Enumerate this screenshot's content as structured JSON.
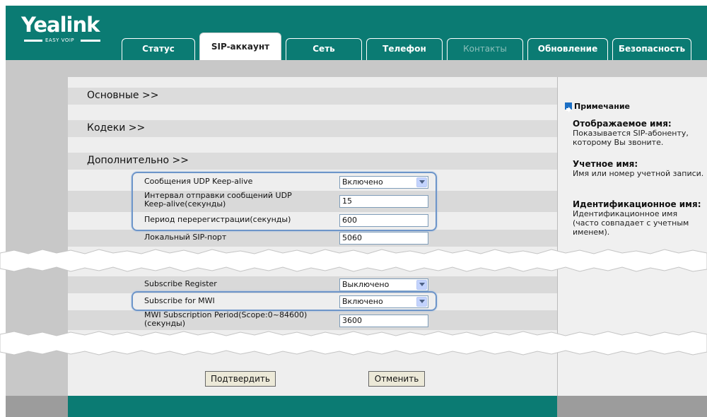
{
  "brand": {
    "name": "Yealink",
    "tagline": "EASY VOIP"
  },
  "tabs": [
    {
      "label": "Статус"
    },
    {
      "label": "SIP-аккаунт"
    },
    {
      "label": "Сеть"
    },
    {
      "label": "Телефон"
    },
    {
      "label": "Контакты"
    },
    {
      "label": "Обновление"
    },
    {
      "label": "Безопасность"
    }
  ],
  "active_tab": "SIP-аккаунт",
  "sections": {
    "basic": "Основные >>",
    "codecs": "Кодеки >>",
    "advanced": "Дополнительно >>"
  },
  "settings": {
    "udp_keepalive_label": "Сообщения UDP Keep-alive",
    "udp_keepalive_value": "Включено",
    "keepalive_interval_label": "Интервал отправки сообщений UDP Keep-alive(секунды)",
    "keepalive_interval_value": "15",
    "reregister_label": "Период перерегистрации(секунды)",
    "reregister_value": "600",
    "local_port_label": "Локальный SIP-порт",
    "local_port_value": "5060",
    "subscribe_register_label": "Subscribe Register",
    "subscribe_register_value": "Выключено",
    "subscribe_mwi_label": "Subscribe for MWI",
    "subscribe_mwi_value": "Включено",
    "mwi_period_label": "MWI Subscription Period(Scope:0~84600) (секунды)",
    "mwi_period_value": "3600"
  },
  "buttons": {
    "confirm": "Подтвердить",
    "cancel": "Отменить"
  },
  "note": {
    "heading": "Примечание",
    "items": [
      {
        "title": "Отображаемое имя:",
        "text": "Показывается SIP-абоненту, которому Вы звоните."
      },
      {
        "title": "Учетное имя:",
        "text": "Имя или номер учетной записи."
      },
      {
        "title": "Идентификационное имя:",
        "text": "Идентификационное имя (часто совпадает с учетным именем)."
      }
    ]
  },
  "colors": {
    "header": "#0b7b73",
    "highlight": "#6d95c9",
    "panel": "#eeeeee",
    "side": "#c8c8c8"
  }
}
